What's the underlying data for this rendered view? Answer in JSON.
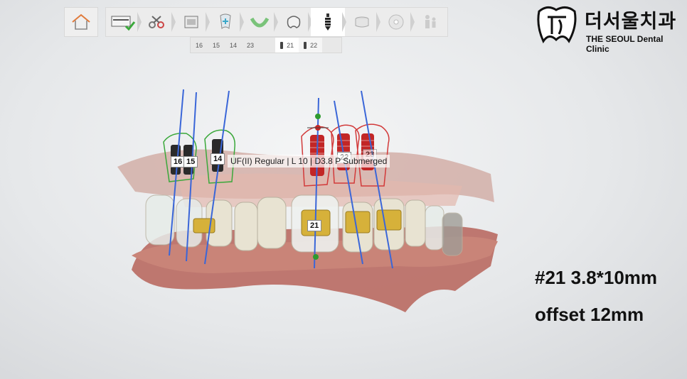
{
  "toolbar": {
    "steps": [
      "scan-card-icon",
      "scissors-icon",
      "frame-icon",
      "tooth-plus-icon",
      "arch-icon",
      "crown-icon",
      "implant-icon",
      "sleeve-icon",
      "disc-icon",
      "people-icon"
    ]
  },
  "tooth_tabs": [
    "16",
    "15",
    "14",
    "23",
    "21",
    "22"
  ],
  "logo": {
    "korean": "더서울치과",
    "english": "THE SEOUL Dental Clinic"
  },
  "tooltip": "UF(II) Regular | L 10 | D3.8 P Submerged",
  "implant_labels": {
    "t16": "16",
    "t15": "15",
    "t14": "14",
    "t21": "21",
    "t22": "22",
    "t23": "23"
  },
  "annotation": {
    "line1": "#21  3.8*10mm",
    "line2": "offset  12mm"
  },
  "colors": {
    "green_guide": "#3aa83a",
    "red_guide": "#d23a3a",
    "axis_blue": "#3a66d8",
    "gold": "#d6b13a"
  }
}
